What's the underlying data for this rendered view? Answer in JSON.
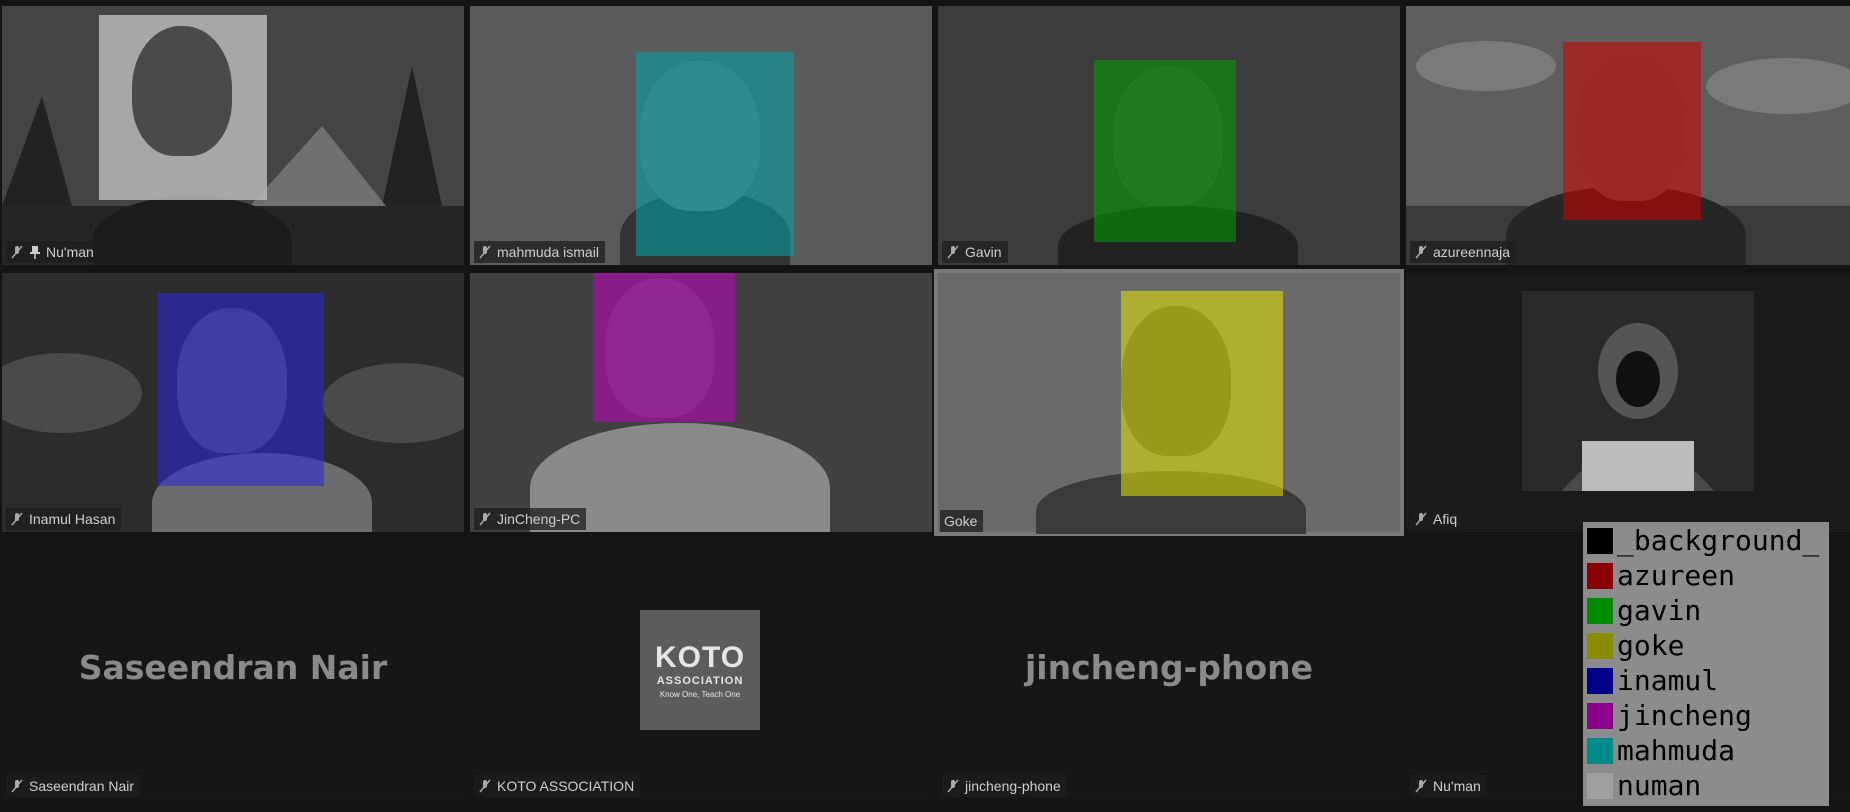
{
  "participants": [
    {
      "name": "Nu'man",
      "pinned": true,
      "overlay_color": "#ffffff"
    },
    {
      "name": "mahmuda ismail",
      "overlay_color": "#00a0a0"
    },
    {
      "name": "Gavin",
      "overlay_color": "#00a000"
    },
    {
      "name": "azureennaja",
      "overlay_color": "#c00000"
    },
    {
      "name": "Inamul Hasan",
      "overlay_color": "#2020d0"
    },
    {
      "name": "JinCheng-PC",
      "overlay_color": "#c000c0"
    },
    {
      "name": "Goke",
      "overlay_color": "#d8d800",
      "active_speaker": true
    },
    {
      "name": "Afiq"
    },
    {
      "name": "Saseendran Nair",
      "display": "Saseendran Nair"
    },
    {
      "name": "KOTO ASSOCIATION",
      "logo": {
        "main": "KOTO",
        "sub": "ASSOCIATION",
        "tagline": "Know One, Teach One"
      }
    },
    {
      "name": "jincheng-phone",
      "display": "jincheng-phone"
    },
    {
      "name": "Nu'man"
    }
  ],
  "legend": [
    {
      "label": "_background_",
      "color": "#000000"
    },
    {
      "label": "azureen",
      "color": "#8b0000"
    },
    {
      "label": "gavin",
      "color": "#008b00"
    },
    {
      "label": "goke",
      "color": "#8b8b00"
    },
    {
      "label": "inamul",
      "color": "#00008b"
    },
    {
      "label": "jincheng",
      "color": "#8b008b"
    },
    {
      "label": "mahmuda",
      "color": "#008b8b"
    },
    {
      "label": "numan",
      "color": "#a0a0a0"
    }
  ],
  "icons": {
    "mic": "mic-off-icon",
    "pin": "pin-icon"
  }
}
